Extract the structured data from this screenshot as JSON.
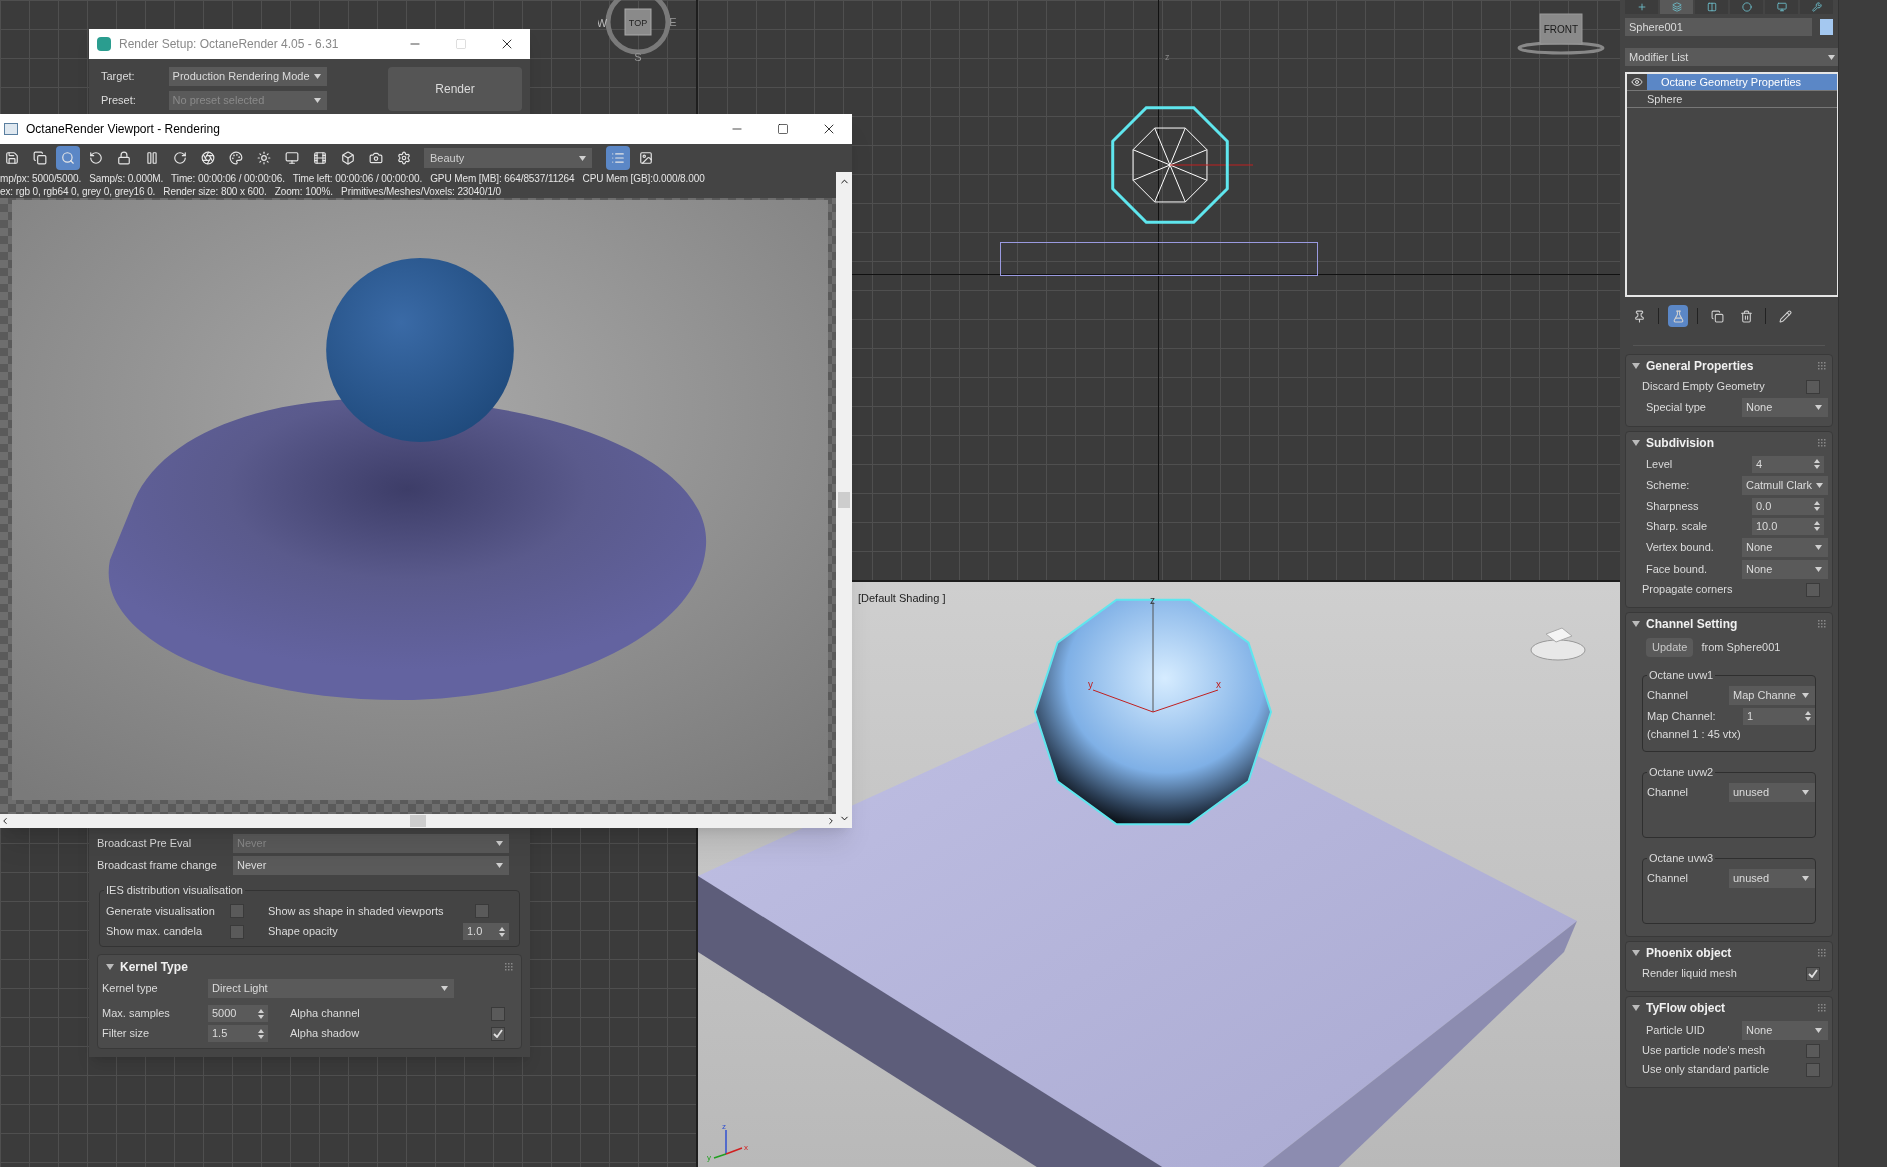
{
  "viewports": {
    "top": {
      "cube_label": "TOP",
      "compass": [
        "W",
        "E",
        "S"
      ]
    },
    "front": {
      "cube_label": "FRONT",
      "axis_labels": [
        "z"
      ]
    },
    "perspective": {
      "label": "[Default Shading ]",
      "object_axis_labels": [
        "z",
        "y",
        "x"
      ],
      "gizmo_labels": [
        "z",
        "y",
        "x"
      ]
    }
  },
  "render_setup": {
    "title": "Render Setup: OctaneRender 4.05 - 6.31",
    "target_label": "Target:",
    "target": "Production Rendering Mode",
    "preset_label": "Preset:",
    "preset_placeholder": "No preset selected",
    "render_button": "Render",
    "broadcast_rows": [
      {
        "label": "Broadcast Pre Eval",
        "value": "Never"
      },
      {
        "label": "Broadcast frame change",
        "value": "Never"
      }
    ],
    "ies": {
      "title": "IES distribution visualisation",
      "options": [
        {
          "label": "Generate visualisation",
          "checked": false
        },
        {
          "label": "Show as shape in shaded viewports",
          "checked": false
        },
        {
          "label": "Show max. candela",
          "checked": false
        }
      ],
      "opacity_label": "Shape opacity",
      "opacity": "1.0"
    },
    "kernel": {
      "title": "Kernel Type",
      "expanded": true,
      "type_label": "Kernel type",
      "type": "Direct Light",
      "max_samples_label": "Max. samples",
      "max_samples": "5000",
      "filter_size_label": "Filter size",
      "filter_size": "1.5",
      "flags": [
        {
          "label": "Alpha channel",
          "checked": false
        },
        {
          "label": "Alpha shadow",
          "checked": true
        }
      ]
    }
  },
  "render_viewport": {
    "title": "OctaneRender Viewport - Rendering",
    "toolbar": [
      {
        "selected": false
      },
      {
        "selected": false
      },
      {
        "selected": true
      },
      {
        "selected": false
      },
      {
        "selected": false
      },
      {
        "selected": false
      },
      {
        "selected": false
      },
      {
        "selected": false
      },
      {
        "selected": false
      },
      {
        "selected": false
      },
      {
        "selected": false
      },
      {
        "selected": false
      },
      {
        "selected": false
      },
      {
        "selected": false
      },
      {
        "selected": false
      }
    ],
    "pass": "Beauty",
    "view_buttons": [
      {
        "selected": true
      },
      {
        "selected": false
      }
    ],
    "stats": [
      "mp/px: 5000/5000.   Samp/s: 0.000M.   Time: 00:00:06 / 00:00:06.   Time left: 00:00:06 / 00:00:00.   GPU Mem [MB]: 664/8537/11264   CPU Mem [GB]:0.000/8.000",
      "ex: rgb 0, rgb64 0, grey 0, grey16 0.   Render size: 800 x 600.   Zoom: 100%.   Primitives/Meshes/Voxels: 23040/1/0"
    ]
  },
  "command_panel": {
    "tabs": [
      {
        "selected": false
      },
      {
        "selected": true
      },
      {
        "selected": false
      },
      {
        "selected": false
      },
      {
        "selected": false
      },
      {
        "selected": false
      }
    ],
    "object_name": "Sphere001",
    "swatch": {
      "color": "#a4c8f0"
    },
    "modifier_list": "Modifier List",
    "stack": [
      {
        "label": "Octane Geometry Properties",
        "selected": true
      },
      {
        "label": "Sphere",
        "selected": false
      }
    ],
    "stack_tools": [
      {
        "selected": false
      },
      {
        "selected": true
      },
      {
        "selected": false
      },
      {
        "selected": false
      },
      {
        "selected": false
      }
    ],
    "rollouts": [
      {
        "title": "General Properties",
        "expanded": true,
        "rows": [
          {
            "kind": "checkbox",
            "label": "Discard Empty Geometry",
            "checked": false
          },
          {
            "kind": "dropdown",
            "label": "Special type",
            "value": "None"
          }
        ]
      },
      {
        "title": "Subdivision",
        "expanded": true,
        "rows": [
          {
            "kind": "spinner",
            "label": "Level",
            "value": "4"
          },
          {
            "kind": "dropdown",
            "label": "Scheme:",
            "value": "Catmull Clark"
          },
          {
            "kind": "spinner",
            "label": "Sharpness",
            "value": "0.0"
          },
          {
            "kind": "spinner",
            "label": "Sharp. scale",
            "value": "10.0"
          },
          {
            "kind": "dropdown",
            "label": "Vertex bound.",
            "value": "None"
          },
          {
            "kind": "dropdown",
            "label": "Face bound.",
            "value": "None"
          },
          {
            "kind": "checkbox",
            "label": "Propagate corners",
            "checked": false
          }
        ]
      },
      {
        "title": "Channel Setting",
        "expanded": true,
        "rows": [
          {
            "kind": "button",
            "label": "Update",
            "note": "from Sphere001"
          },
          {
            "kind": "group",
            "title": "Octane uvw1",
            "rows": [
              {
                "kind": "dropdown",
                "label": "Channel",
                "value": "Map Channe"
              },
              {
                "kind": "spinner",
                "label": "Map Channel:",
                "value": "1"
              },
              {
                "kind": "note",
                "label": "(channel 1 : 45 vtx)"
              }
            ]
          },
          {
            "kind": "group",
            "title": "Octane uvw2",
            "rows": [
              {
                "kind": "dropdown",
                "label": "Channel",
                "value": "unused"
              }
            ]
          },
          {
            "kind": "group",
            "title": "Octane uvw3",
            "rows": [
              {
                "kind": "dropdown",
                "label": "Channel",
                "value": "unused"
              }
            ]
          }
        ]
      },
      {
        "title": "Phoenix object",
        "expanded": true,
        "rows": [
          {
            "kind": "checkbox",
            "label": "Render liquid mesh",
            "checked": true
          }
        ]
      },
      {
        "title": "TyFlow object",
        "expanded": true,
        "rows": [
          {
            "kind": "dropdown",
            "label": "Particle UID",
            "value": "None"
          },
          {
            "kind": "checkbox",
            "label": "Use particle node's mesh",
            "checked": false
          },
          {
            "kind": "checkbox",
            "label": "Use only standard particle",
            "checked": false
          }
        ]
      }
    ]
  }
}
